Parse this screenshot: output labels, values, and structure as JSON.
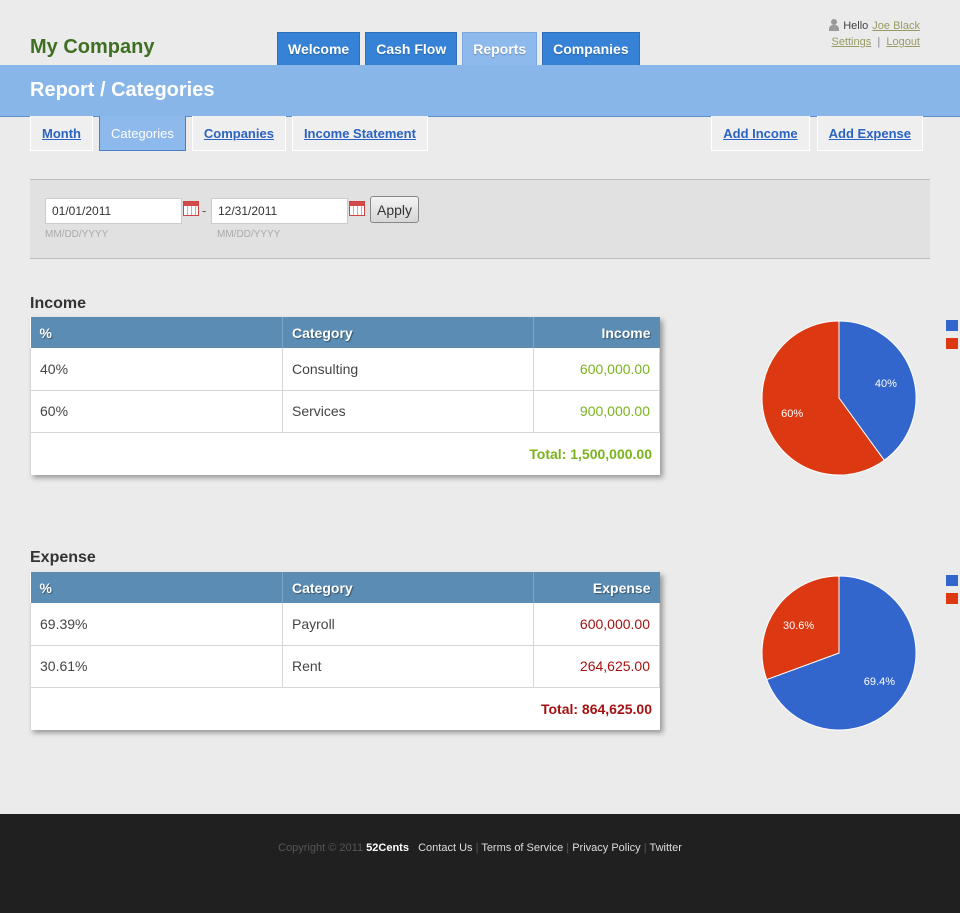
{
  "header": {
    "brand": "My Company",
    "nav": [
      "Welcome",
      "Cash Flow",
      "Reports",
      "Companies"
    ],
    "active_nav": "Reports",
    "user": {
      "hello": "Hello",
      "name": "Joe Black",
      "settings": "Settings",
      "logout": "Logout",
      "separator": "|"
    }
  },
  "page_title": "Report / Categories",
  "subtabs": [
    "Month",
    "Categories",
    "Companies",
    "Income Statement"
  ],
  "active_subtab": "Categories",
  "actions": {
    "add_income": "Add Income",
    "add_expense": "Add Expense"
  },
  "filter": {
    "start_date": "01/01/2011",
    "end_date": "12/31/2011",
    "separator": "-",
    "format_hint": "MM/DD/YYYY",
    "apply_label": "Apply"
  },
  "income": {
    "title": "Income",
    "columns": [
      "%",
      "Category",
      "Income"
    ],
    "rows": [
      {
        "pct": "40%",
        "category": "Consulting",
        "amount": "600,000.00"
      },
      {
        "pct": "60%",
        "category": "Services",
        "amount": "900,000.00"
      }
    ],
    "total": "Total: 1,500,000.00",
    "pie": {
      "slices": [
        {
          "pct": 40,
          "label": "40%",
          "color": "#3366cc"
        },
        {
          "pct": 60,
          "label": "60%",
          "color": "#dc3912"
        }
      ]
    }
  },
  "expense": {
    "title": "Expense",
    "columns": [
      "%",
      "Category",
      "Expense"
    ],
    "rows": [
      {
        "pct": "69.39%",
        "category": "Payroll",
        "amount": "600,000.00"
      },
      {
        "pct": "30.61%",
        "category": "Rent",
        "amount": "264,625.00"
      }
    ],
    "total": "Total: 864,625.00",
    "pie": {
      "slices": [
        {
          "pct": 69.4,
          "label": "69.4%",
          "color": "#3366cc"
        },
        {
          "pct": 30.6,
          "label": "30.6%",
          "color": "#dc3912"
        }
      ]
    }
  },
  "footer": {
    "copyright": "Copyright © 2011",
    "brand": "52Cents",
    "links": [
      "Contact Us",
      "Terms of Service",
      "Privacy Policy",
      "Twitter"
    ]
  }
}
